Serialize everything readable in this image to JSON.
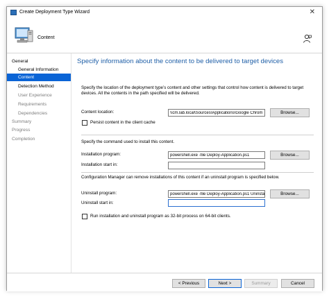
{
  "window": {
    "title": "Create Deployment Type Wizard",
    "close_glyph": "✕"
  },
  "header": {
    "page_label": "Content"
  },
  "sidebar": {
    "items": [
      {
        "label": "General"
      },
      {
        "label": "General Information"
      },
      {
        "label": "Content"
      },
      {
        "label": "Detection Method"
      },
      {
        "label": "User Experience"
      },
      {
        "label": "Requirements"
      },
      {
        "label": "Dependencies"
      },
      {
        "label": "Summary"
      },
      {
        "label": "Progress"
      },
      {
        "label": "Completion"
      }
    ]
  },
  "main": {
    "title": "Specify information about the content to be delivered to target devices",
    "content_desc": "Specify the location of the deployment type’s content and other settings that control how content is delivered to target devices. All the contents in the path specified will be delivered.",
    "content_location_label": "Content location:",
    "content_location_value": "\\\\cm.lab.local\\Sources\\Applications\\Google Chrom",
    "persist_label": "Persist content in the client cache",
    "command_desc": "Specify the command used to install this content.",
    "install_program_label": "Installation program:",
    "install_program_value": "powershell.exe -file Deploy-Application.ps1",
    "install_start_label": "Installation start in:",
    "install_start_value": "",
    "uninstall_desc": "Configuration Manager can remove installations of this content if an uninstall program is specified below.",
    "uninstall_program_label": "Uninstall program:",
    "uninstall_program_value": "powershell.exe -file Deploy-Application.ps1 Uninsta",
    "uninstall_start_label": "Uninstall start in:",
    "uninstall_start_value": "",
    "run32_label": "Run installation and uninstall program as 32-bit process on 64-bit clients.",
    "browse_label": "Browse..."
  },
  "footer": {
    "previous_label": "< Previous",
    "next_label": "Next >",
    "summary_label": "Summary",
    "cancel_label": "Cancel"
  },
  "colors": {
    "accent": "#0a64d6",
    "title_blue": "#1f5fa7"
  }
}
